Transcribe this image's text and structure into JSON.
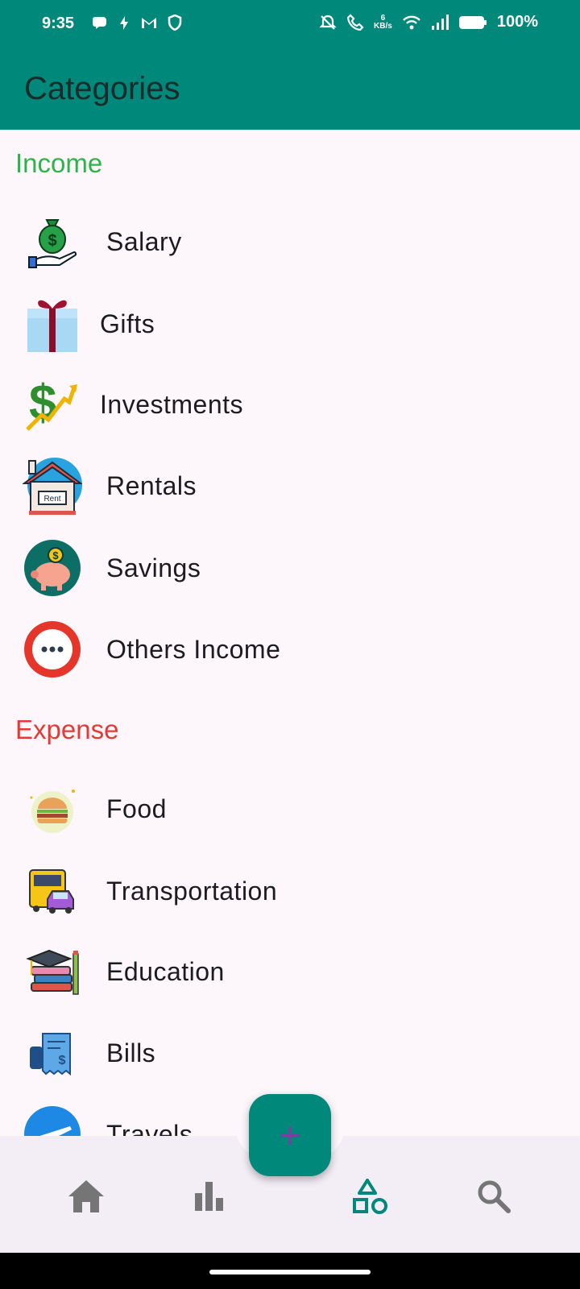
{
  "status_bar": {
    "time": "9:35",
    "speed_value": "6",
    "speed_unit": "KB/s",
    "battery": "100%"
  },
  "app_bar": {
    "title": "Categories"
  },
  "income": {
    "title": "Income",
    "items": [
      {
        "label": "Salary",
        "icon": "money-bag-hand-icon"
      },
      {
        "label": "Gifts",
        "icon": "gift-box-icon"
      },
      {
        "label": "Investments",
        "icon": "dollar-growth-icon"
      },
      {
        "label": "Rentals",
        "icon": "rent-house-icon"
      },
      {
        "label": "Savings",
        "icon": "piggy-bank-icon"
      },
      {
        "label": "Others Income",
        "icon": "more-dots-icon"
      }
    ]
  },
  "expense": {
    "title": "Expense",
    "items": [
      {
        "label": "Food",
        "icon": "burger-icon"
      },
      {
        "label": "Transportation",
        "icon": "bus-car-icon"
      },
      {
        "label": "Education",
        "icon": "books-cap-icon"
      },
      {
        "label": "Bills",
        "icon": "receipt-icon"
      },
      {
        "label": "Travels",
        "icon": "airplane-icon"
      }
    ]
  },
  "fab": {
    "label": "+"
  },
  "bottom_nav": [
    {
      "name": "home",
      "icon": "home-icon",
      "active": false
    },
    {
      "name": "stats",
      "icon": "bar-chart-icon",
      "active": false
    },
    {
      "name": "categories",
      "icon": "shapes-icon",
      "active": true
    },
    {
      "name": "search",
      "icon": "search-icon",
      "active": false
    }
  ],
  "colors": {
    "primary": "#00897b",
    "income": "#2db34a",
    "expense": "#e53935",
    "background": "#fdf7fc",
    "nav_background": "#f3edf5",
    "nav_inactive": "#757575"
  }
}
